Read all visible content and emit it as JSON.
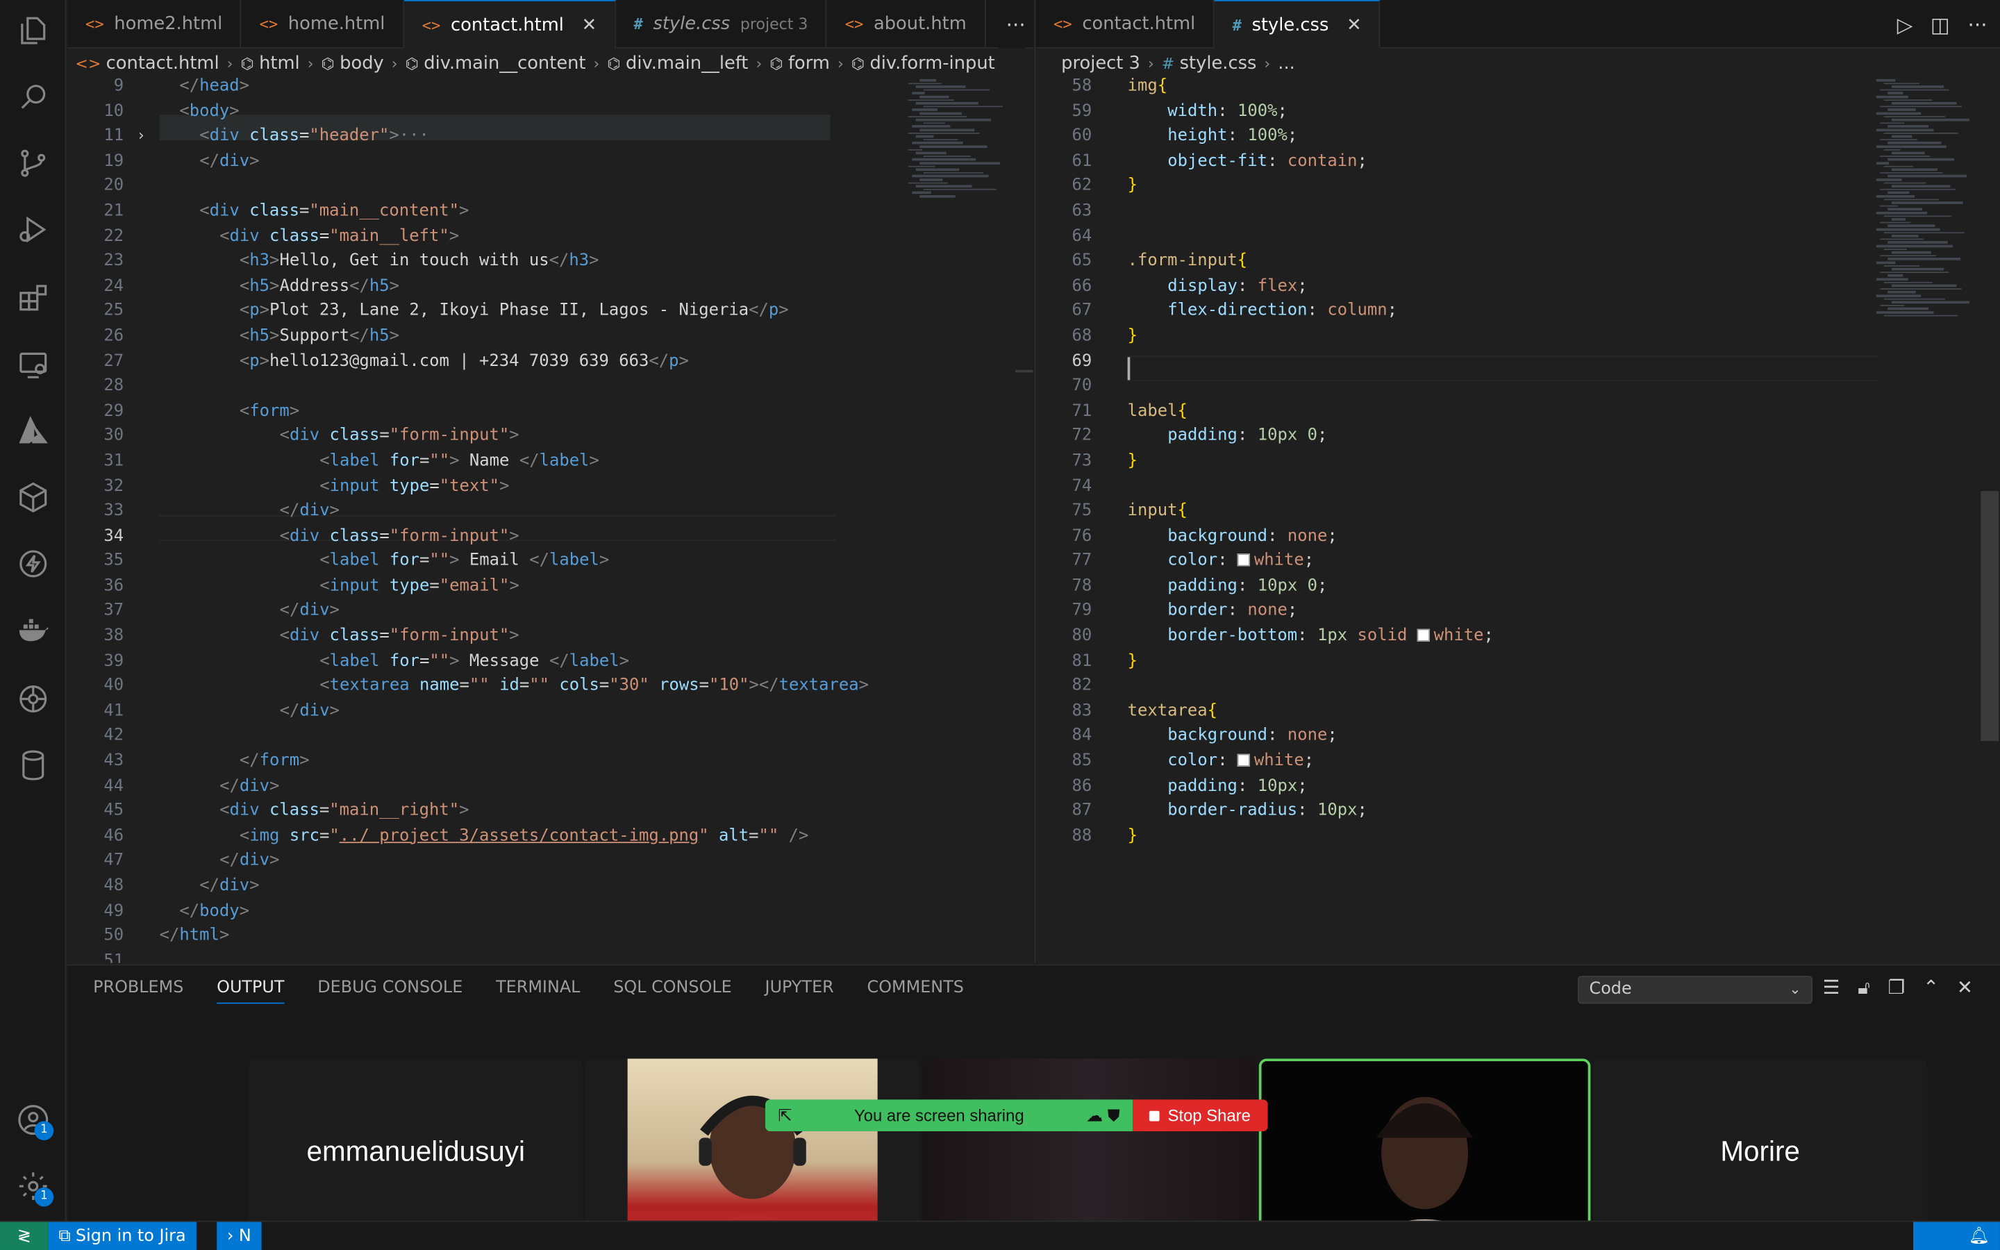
{
  "left_tabs": [
    {
      "label": "home2.html",
      "icon": "html",
      "active": false
    },
    {
      "label": "home.html",
      "icon": "html",
      "active": false
    },
    {
      "label": "contact.html",
      "icon": "html",
      "active": true
    },
    {
      "label": "style.css",
      "icon": "css",
      "active": false,
      "tag": "project 3",
      "italic": true
    },
    {
      "label": "about.htm",
      "icon": "html",
      "active": false
    }
  ],
  "right_tabs": [
    {
      "label": "contact.html",
      "icon": "html",
      "active": false
    },
    {
      "label": "style.css",
      "icon": "css",
      "active": true
    }
  ],
  "left_breadcrumb": [
    "contact.html",
    "html",
    "body",
    "div.main__content",
    "div.main__left",
    "form",
    "div.form-input"
  ],
  "right_breadcrumb": [
    "project 3",
    "style.css",
    "..."
  ],
  "html_lines": [
    {
      "n": "9",
      "html": "<span class='t-tag'>&lt;/</span><span class='t-name'>head</span><span class='t-tag'>&gt;</span>",
      "indent": 1
    },
    {
      "n": "10",
      "html": "<span class='t-tag'>&lt;</span><span class='t-name'>body</span><span class='t-tag'>&gt;</span>",
      "indent": 1
    },
    {
      "n": "11",
      "html": "<span class='t-tag'>&lt;</span><span class='t-name'>div</span> <span class='t-attr'>class</span>=<span class='t-str'>\"header\"</span><span class='t-tag'>&gt;</span><span class='t-tag'>···</span>",
      "indent": 2
    },
    {
      "n": "19",
      "html": "<span class='t-tag'>&lt;/</span><span class='t-name'>div</span><span class='t-tag'>&gt;</span>",
      "indent": 2
    },
    {
      "n": "20",
      "html": "",
      "indent": 0
    },
    {
      "n": "21",
      "html": "<span class='t-tag'>&lt;</span><span class='t-name'>div</span> <span class='t-attr'>class</span>=<span class='t-str'>\"main__content\"</span><span class='t-tag'>&gt;</span>",
      "indent": 2
    },
    {
      "n": "22",
      "html": "<span class='t-tag'>&lt;</span><span class='t-name'>div</span> <span class='t-attr'>class</span>=<span class='t-str'>\"main__left\"</span><span class='t-tag'>&gt;</span>",
      "indent": 3
    },
    {
      "n": "23",
      "html": "<span class='t-tag'>&lt;</span><span class='t-name'>h3</span><span class='t-tag'>&gt;</span>Hello, Get in touch with us<span class='t-tag'>&lt;/</span><span class='t-name'>h3</span><span class='t-tag'>&gt;</span>",
      "indent": 4
    },
    {
      "n": "24",
      "html": "<span class='t-tag'>&lt;</span><span class='t-name'>h5</span><span class='t-tag'>&gt;</span>Address<span class='t-tag'>&lt;/</span><span class='t-name'>h5</span><span class='t-tag'>&gt;</span>",
      "indent": 4
    },
    {
      "n": "25",
      "html": "<span class='t-tag'>&lt;</span><span class='t-name'>p</span><span class='t-tag'>&gt;</span>Plot 23, Lane 2, Ikoyi Phase II, Lagos - Nigeria<span class='t-tag'>&lt;/</span><span class='t-name'>p</span><span class='t-tag'>&gt;</span>",
      "indent": 4
    },
    {
      "n": "26",
      "html": "<span class='t-tag'>&lt;</span><span class='t-name'>h5</span><span class='t-tag'>&gt;</span>Support<span class='t-tag'>&lt;/</span><span class='t-name'>h5</span><span class='t-tag'>&gt;</span>",
      "indent": 4
    },
    {
      "n": "27",
      "html": "<span class='t-tag'>&lt;</span><span class='t-name'>p</span><span class='t-tag'>&gt;</span>hello123@gmail.com | +234 7039 639 663<span class='t-tag'>&lt;/</span><span class='t-name'>p</span><span class='t-tag'>&gt;</span>",
      "indent": 4
    },
    {
      "n": "28",
      "html": "",
      "indent": 0
    },
    {
      "n": "29",
      "html": "<span class='t-tag'>&lt;</span><span class='t-name'>form</span><span class='t-tag'>&gt;</span>",
      "indent": 4
    },
    {
      "n": "30",
      "html": "<span class='t-tag'>&lt;</span><span class='t-name'>div</span> <span class='t-attr'>class</span>=<span class='t-str'>\"form-input\"</span><span class='t-tag'>&gt;</span>",
      "indent": 6
    },
    {
      "n": "31",
      "html": "<span class='t-tag'>&lt;</span><span class='t-name'>label</span> <span class='t-attr'>for</span>=<span class='t-str'>\"\"</span><span class='t-tag'>&gt;</span> Name <span class='t-tag'>&lt;/</span><span class='t-name'>label</span><span class='t-tag'>&gt;</span>",
      "indent": 8
    },
    {
      "n": "32",
      "html": "<span class='t-tag'>&lt;</span><span class='t-name'>input</span> <span class='t-attr'>type</span>=<span class='t-str'>\"text\"</span><span class='t-tag'>&gt;</span>",
      "indent": 8
    },
    {
      "n": "33",
      "html": "<span class='t-tag'>&lt;/</span><span class='t-name'>div</span><span class='t-tag'>&gt;</span>",
      "indent": 6
    },
    {
      "n": "34",
      "html": "<span class='t-tag'>&lt;</span><span class='t-name'>div</span> <span class='t-attr'>class</span>=<span class='t-str'>\"form-input\"</span><span class='t-tag'>&gt;</span>",
      "indent": 6
    },
    {
      "n": "35",
      "html": "<span class='t-tag'>&lt;</span><span class='t-name'>label</span> <span class='t-attr'>for</span>=<span class='t-str'>\"\"</span><span class='t-tag'>&gt;</span> Email <span class='t-tag'>&lt;/</span><span class='t-name'>label</span><span class='t-tag'>&gt;</span>",
      "indent": 8
    },
    {
      "n": "36",
      "html": "<span class='t-tag'>&lt;</span><span class='t-name'>input</span> <span class='t-attr'>type</span>=<span class='t-str'>\"email\"</span><span class='t-tag'>&gt;</span>",
      "indent": 8
    },
    {
      "n": "37",
      "html": "<span class='t-tag'>&lt;/</span><span class='t-name'>div</span><span class='t-tag'>&gt;</span>",
      "indent": 6
    },
    {
      "n": "38",
      "html": "<span class='t-tag'>&lt;</span><span class='t-name'>div</span> <span class='t-attr'>class</span>=<span class='t-str'>\"form-input\"</span><span class='t-tag'>&gt;</span>",
      "indent": 6
    },
    {
      "n": "39",
      "html": "<span class='t-tag'>&lt;</span><span class='t-name'>label</span> <span class='t-attr'>for</span>=<span class='t-str'>\"\"</span><span class='t-tag'>&gt;</span> Message <span class='t-tag'>&lt;/</span><span class='t-name'>label</span><span class='t-tag'>&gt;</span>",
      "indent": 8
    },
    {
      "n": "40",
      "html": "<span class='t-tag'>&lt;</span><span class='t-name'>textarea</span> <span class='t-attr'>name</span>=<span class='t-str'>\"\"</span> <span class='t-attr'>id</span>=<span class='t-str'>\"\"</span> <span class='t-attr'>cols</span>=<span class='t-str'>\"30\"</span> <span class='t-attr'>rows</span>=<span class='t-str'>\"10\"</span><span class='t-tag'>&gt;&lt;/</span><span class='t-name'>textarea</span><span class='t-tag'>&gt;</span>",
      "indent": 8
    },
    {
      "n": "41",
      "html": "<span class='t-tag'>&lt;/</span><span class='t-name'>div</span><span class='t-tag'>&gt;</span>",
      "indent": 6
    },
    {
      "n": "42",
      "html": "",
      "indent": 0
    },
    {
      "n": "43",
      "html": "<span class='t-tag'>&lt;/</span><span class='t-name'>form</span><span class='t-tag'>&gt;</span>",
      "indent": 4
    },
    {
      "n": "44",
      "html": "<span class='t-tag'>&lt;/</span><span class='t-name'>div</span><span class='t-tag'>&gt;</span>",
      "indent": 3
    },
    {
      "n": "45",
      "html": "<span class='t-tag'>&lt;</span><span class='t-name'>div</span> <span class='t-attr'>class</span>=<span class='t-str'>\"main__right\"</span><span class='t-tag'>&gt;</span>",
      "indent": 3
    },
    {
      "n": "46",
      "html": "<span class='t-tag'>&lt;</span><span class='t-name'>img</span> <span class='t-attr'>src</span>=<span class='t-str'>\"</span><span class='t-link'>../ project 3/assets/contact-img.png</span><span class='t-str'>\"</span> <span class='t-attr'>alt</span>=<span class='t-str'>\"\"</span> <span class='t-tag'>/&gt;</span>",
      "indent": 4
    },
    {
      "n": "47",
      "html": "<span class='t-tag'>&lt;/</span><span class='t-name'>div</span><span class='t-tag'>&gt;</span>",
      "indent": 3
    },
    {
      "n": "48",
      "html": "<span class='t-tag'>&lt;/</span><span class='t-name'>div</span><span class='t-tag'>&gt;</span>",
      "indent": 2
    },
    {
      "n": "49",
      "html": "<span class='t-tag'>&lt;/</span><span class='t-name'>body</span><span class='t-tag'>&gt;</span>",
      "indent": 1
    },
    {
      "n": "50",
      "html": "<span class='t-tag'>&lt;/</span><span class='t-name'>html</span><span class='t-tag'>&gt;</span>",
      "indent": 0
    },
    {
      "n": "51",
      "html": "",
      "indent": 0
    }
  ],
  "css_lines": [
    {
      "n": "58",
      "html": "<span class='t-sel'>img</span><span class='t-br'>{</span>",
      "indent": 0
    },
    {
      "n": "59",
      "html": "<span class='t-prop'>width</span>: <span class='t-num'>100%</span>;",
      "indent": 2
    },
    {
      "n": "60",
      "html": "<span class='t-prop'>height</span>: <span class='t-num'>100%</span>;",
      "indent": 2
    },
    {
      "n": "61",
      "html": "<span class='t-prop'>object-fit</span>: <span class='t-val'>contain</span>;",
      "indent": 2
    },
    {
      "n": "62",
      "html": "<span class='t-br'>}</span>",
      "indent": 0
    },
    {
      "n": "63",
      "html": "",
      "indent": 0
    },
    {
      "n": "64",
      "html": "",
      "indent": 0
    },
    {
      "n": "65",
      "html": "<span class='t-sel'>.form-input</span><span class='t-br'>{</span>",
      "indent": 0
    },
    {
      "n": "66",
      "html": "<span class='t-prop'>display</span>: <span class='t-val'>flex</span>;",
      "indent": 2
    },
    {
      "n": "67",
      "html": "<span class='t-prop'>flex-direction</span>: <span class='t-val'>column</span>;",
      "indent": 2
    },
    {
      "n": "68",
      "html": "<span class='t-br'>}</span>",
      "indent": 0
    },
    {
      "n": "69",
      "html": "",
      "indent": 0
    },
    {
      "n": "70",
      "html": "",
      "indent": 0
    },
    {
      "n": "71",
      "html": "<span class='t-sel'>label</span><span class='t-br'>{</span>",
      "indent": 0
    },
    {
      "n": "72",
      "html": "<span class='t-prop'>padding</span>: <span class='t-num'>10px 0</span>;",
      "indent": 2
    },
    {
      "n": "73",
      "html": "<span class='t-br'>}</span>",
      "indent": 0
    },
    {
      "n": "74",
      "html": "",
      "indent": 0
    },
    {
      "n": "75",
      "html": "<span class='t-sel'>input</span><span class='t-br'>{</span>",
      "indent": 0
    },
    {
      "n": "76",
      "html": "<span class='t-prop'>background</span>: <span class='t-val'>none</span>;",
      "indent": 2
    },
    {
      "n": "77",
      "html": "<span class='t-prop'>color</span>: <span class='swatch'></span><span class='t-val'>white</span>;",
      "indent": 2
    },
    {
      "n": "78",
      "html": "<span class='t-prop'>padding</span>: <span class='t-num'>10px 0</span>;",
      "indent": 2
    },
    {
      "n": "79",
      "html": "<span class='t-prop'>border</span>: <span class='t-val'>none</span>;",
      "indent": 2
    },
    {
      "n": "80",
      "html": "<span class='t-prop'>border-bottom</span>: <span class='t-num'>1px</span> <span class='t-val'>solid</span> <span class='swatch'></span><span class='t-val'>white</span>;",
      "indent": 2
    },
    {
      "n": "81",
      "html": "<span class='t-br'>}</span>",
      "indent": 0
    },
    {
      "n": "82",
      "html": "",
      "indent": 0
    },
    {
      "n": "83",
      "html": "<span class='t-sel'>textarea</span><span class='t-br'>{</span>",
      "indent": 0
    },
    {
      "n": "84",
      "html": "<span class='t-prop'>background</span>: <span class='t-val'>none</span>;",
      "indent": 2
    },
    {
      "n": "85",
      "html": "<span class='t-prop'>color</span>: <span class='swatch'></span><span class='t-val'>white</span>;",
      "indent": 2
    },
    {
      "n": "86",
      "html": "<span class='t-prop'>padding</span>: <span class='t-num'>10px</span>;",
      "indent": 2
    },
    {
      "n": "87",
      "html": "<span class='t-prop'>border-radius</span>: <span class='t-num'>10px</span>;",
      "indent": 2
    },
    {
      "n": "88",
      "html": "<span class='t-br'>}</span>",
      "indent": 0
    }
  ],
  "panel": {
    "tabs": [
      "PROBLEMS",
      "OUTPUT",
      "DEBUG CONSOLE",
      "TERMINAL",
      "SQL CONSOLE",
      "JUPYTER",
      "COMMENTS"
    ],
    "active_tab": "OUTPUT",
    "output_channel": "Code"
  },
  "meeting": {
    "participant_1": "emmanuelidusuyi",
    "participant_2": "Morire",
    "share_text": "You are screen sharing",
    "stop_label": "Stop Share"
  },
  "status": {
    "jira": "Sign in to Jira",
    "next": "N"
  },
  "badges": {
    "accounts": "1",
    "settings": "1"
  },
  "colors": {
    "accent": "#0078d4",
    "share_green": "#3fbf5f",
    "stop_red": "#e02828"
  }
}
